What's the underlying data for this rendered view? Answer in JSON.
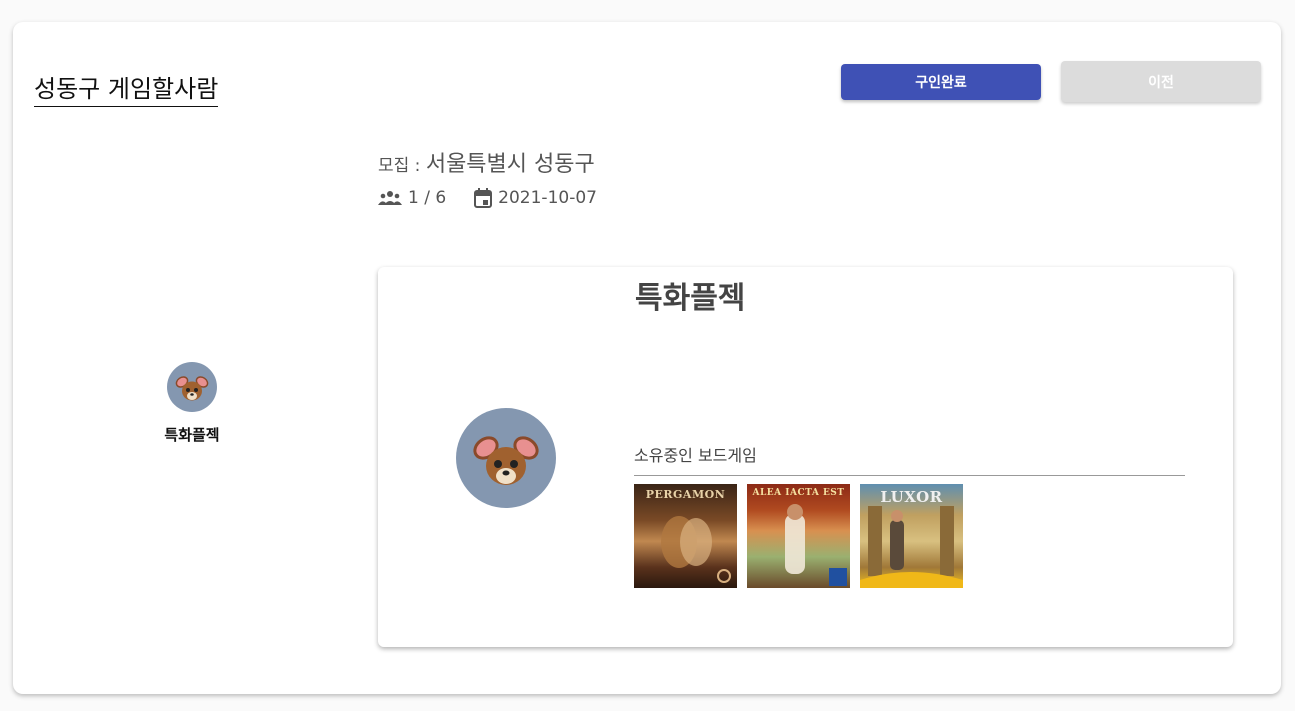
{
  "header": {
    "title": "성동구 게임할사람",
    "complete_button": "구인완료",
    "prev_button": "이전"
  },
  "recruit": {
    "label": "모집 : ",
    "location": "서울특별시 성동구"
  },
  "meta": {
    "people": "1 / 6",
    "date": "2021-10-07",
    "people_icon": "group-icon",
    "date_icon": "calendar-icon"
  },
  "member": {
    "name": "특화플젝",
    "avatar_icon": "deer-avatar-icon"
  },
  "detail": {
    "name": "특화플젝",
    "owned_label": "소유중인 보드게임",
    "games": [
      {
        "title": "PERGAMON",
        "color": "#3a2416"
      },
      {
        "title": "ALEA IACTA EST",
        "color": "#8c2a16"
      },
      {
        "title": "LUXOR",
        "color": "#5f8fb0"
      }
    ]
  },
  "colors": {
    "primary": "#3f51b5",
    "disabled": "#dcdcdc",
    "avatar_bg": "#8497b0"
  }
}
